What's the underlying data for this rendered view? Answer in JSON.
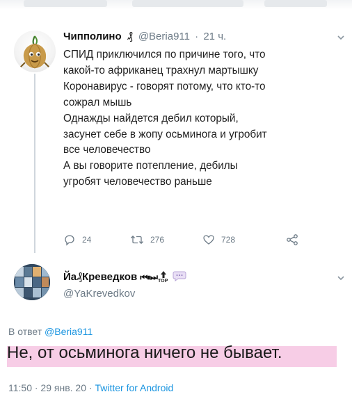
{
  "tweet": {
    "author_name": "Чипполино",
    "author_badge_glyph": "₰",
    "author_handle": "@Beria911",
    "time_sep": "·",
    "time_ago": "21 ч.",
    "lines": [
      "СПИД приключился по причине того, что",
      "какой-то африканец трахнул мартышку",
      "Коронавирус - говорят потому, что кто-то",
      "сожрал мышь",
      "Однажды найдется дебил который,",
      "засунет себе в жопу осьминога и угробит",
      "все человечество",
      "А вы говорите потепление, дебилы",
      "угробят человечество раньше"
    ],
    "actions": {
      "replies": "24",
      "retweets": "276",
      "likes": "728"
    }
  },
  "reply": {
    "author_name_prefix": "Йа",
    "author_badge_glyph": "₰",
    "author_name": "Креведков",
    "author_suffix": "⏮⏸⏭",
    "author_top": "TOP",
    "author_handle": "@YaKrevedkov",
    "reply_to_label": "В ответ",
    "reply_to_handle": "@Beria911",
    "text": "Не, от осьминога ничего не бывает.",
    "timestamp": "11:50 · 29 янв. 20 ·",
    "client": "Twitter for Android"
  },
  "icons": [
    "avatar-onion",
    "reply-icon",
    "retweet-icon",
    "like-icon",
    "share-icon",
    "chevron-down-icon",
    "avatar-collage"
  ],
  "colors": {
    "link": "#1b95e0",
    "muted": "#6c7a86",
    "highlight": "#f7cde6"
  }
}
